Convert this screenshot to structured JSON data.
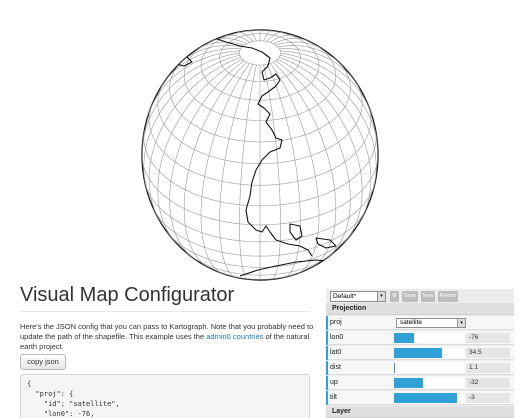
{
  "page": {
    "title": "Visual Map Configurator",
    "intro_before_link": "Here's the JSON config that you can pass to Kartograph. Note that you probably need to update the path of the shapefile. This example uses the ",
    "intro_link": "admin0 countries",
    "intro_after_link": " of the natural earth project.",
    "copy_button": "copy json",
    "code_lines": [
      "{",
      "  \"proj\": {",
      "    \"id\": \"satellite\",",
      "    \"lon0\": -76,"
    ]
  },
  "panel": {
    "preset": "Default*",
    "buttons": [
      "Save",
      "New",
      "Revert"
    ],
    "projection_heading": "Projection",
    "proj_row": {
      "label": "proj",
      "value": "satellite"
    },
    "params": [
      {
        "label": "lon0",
        "value": "-76",
        "fraction": 0.29
      },
      {
        "label": "lat0",
        "value": "34.5",
        "fraction": 0.69
      },
      {
        "label": "dist",
        "value": "1.1",
        "fraction": 0.02
      },
      {
        "label": "up",
        "value": "-32",
        "fraction": 0.41
      },
      {
        "label": "tilt",
        "value": "-3",
        "fraction": 0.9
      }
    ],
    "layer_heading": "Layer",
    "accent_color": "#2fa1d6"
  },
  "map": {
    "projection": "satellite",
    "lon0": -76,
    "lat0": 34.5
  }
}
